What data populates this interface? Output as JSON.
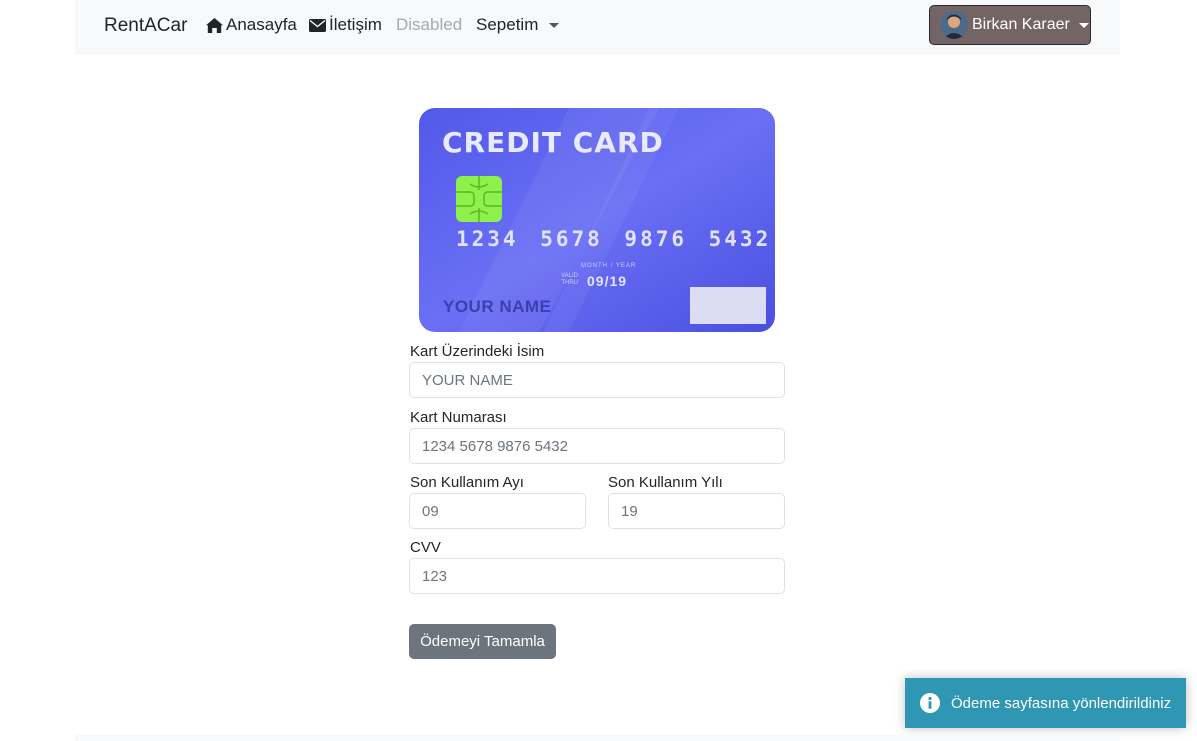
{
  "navbar": {
    "brand": "RentACar",
    "links": [
      {
        "label": "Anasayfa",
        "icon": "home-icon"
      },
      {
        "label": "İletişim",
        "icon": "envelope-icon"
      },
      {
        "label": "Disabled"
      },
      {
        "label": "Sepetim"
      }
    ],
    "user": {
      "name": "Birkan Karaer"
    }
  },
  "card": {
    "title": "CREDIT CARD",
    "number": "1234 5678 9876 5432",
    "month_year_caption": "MONTH / YEAR",
    "valid_thru": "VALID THRU",
    "expiry": "09/19",
    "holder": "YOUR NAME"
  },
  "form": {
    "name_label": "Kart Üzerindeki İsim",
    "name_placeholder": "YOUR NAME",
    "number_label": "Kart Numarası",
    "number_placeholder": "1234 5678 9876 5432",
    "month_label": "Son Kullanım Ayı",
    "month_placeholder": "09",
    "year_label": "Son Kullanım Yılı",
    "year_placeholder": "19",
    "cvv_label": "CVV",
    "cvv_placeholder": "123",
    "submit_label": "Ödemeyi Tamamla"
  },
  "toast": {
    "message": "Ödeme sayfasına yönlendirildiniz",
    "icon": "info-circle-icon",
    "color": "#2f96b4"
  }
}
